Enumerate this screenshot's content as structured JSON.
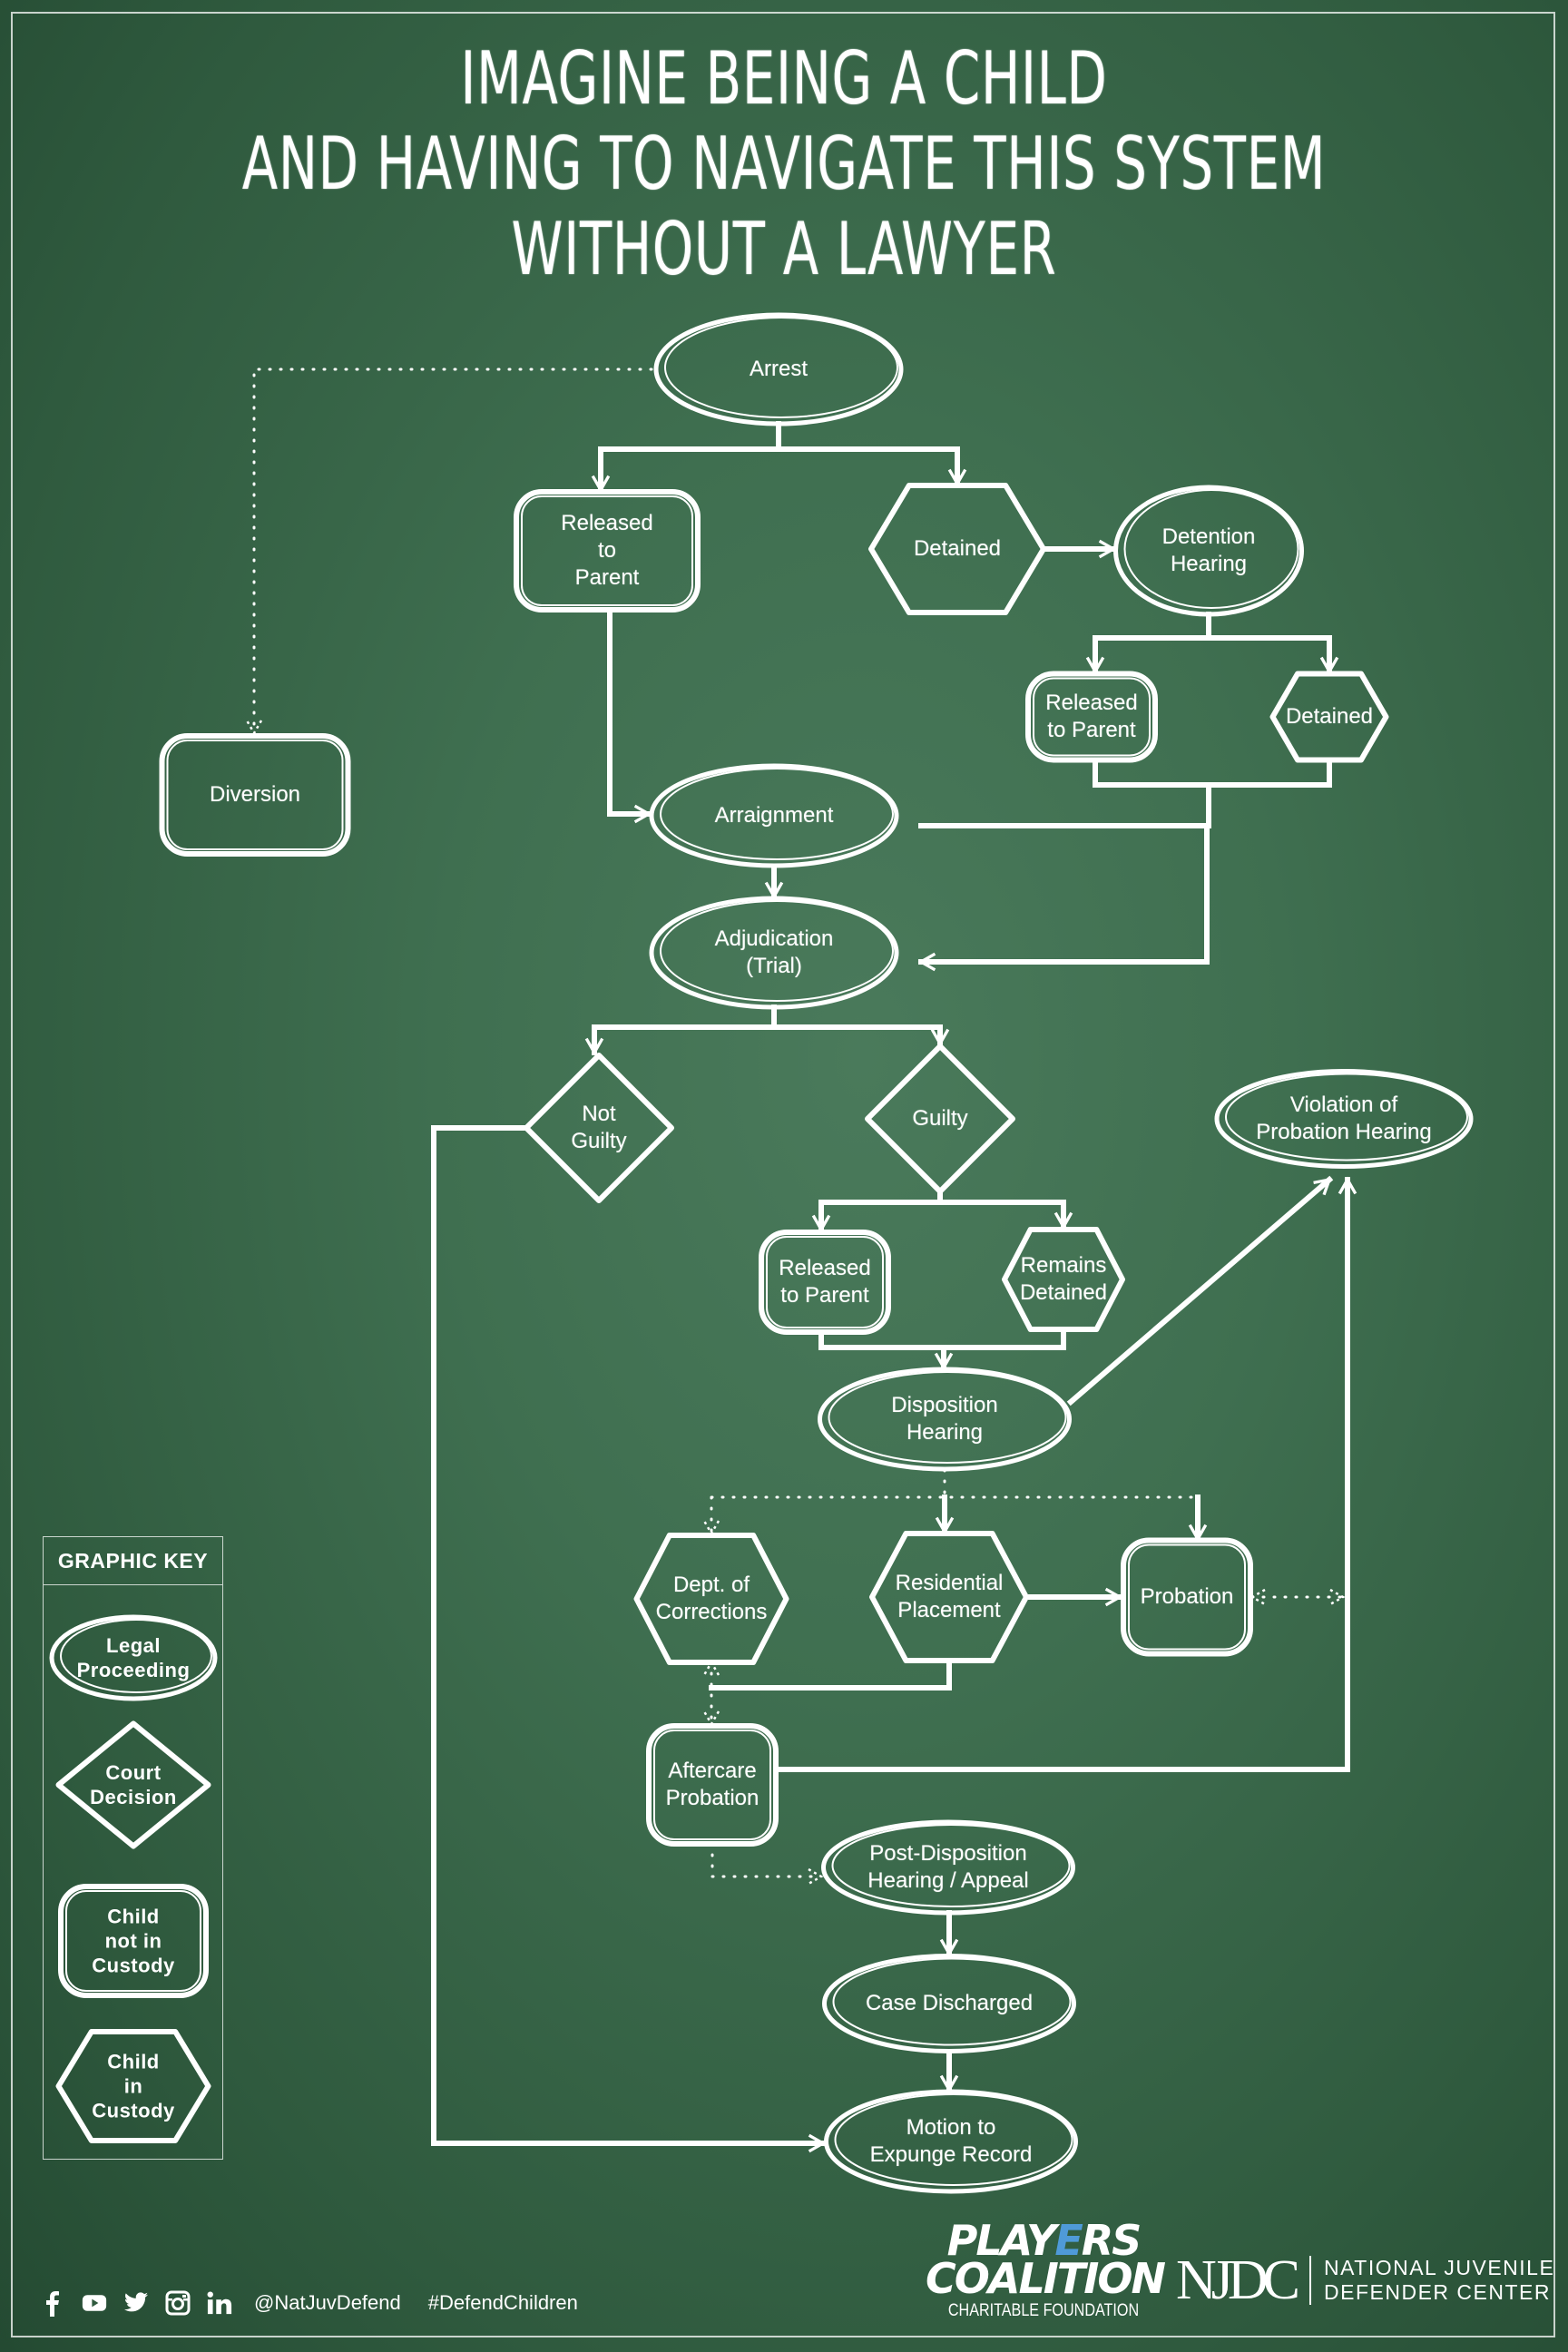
{
  "title": {
    "lines": [
      "IMAGINE BEING A CHILD",
      "AND HAVING TO NAVIGATE THIS SYSTEM",
      "WITHOUT A LAWYER"
    ]
  },
  "colors": {
    "background": "#3f6f50",
    "chalk": "#ffffff",
    "players_blue": "#4f9ad8"
  },
  "nodes": {
    "arrest": {
      "label": "Arrest",
      "shape": "legal-proceeding"
    },
    "released_to_parent_1": {
      "label": "Released\nto\nParent",
      "shape": "child-not-in-custody"
    },
    "detained_1": {
      "label": "Detained",
      "shape": "child-in-custody"
    },
    "detention_hearing": {
      "label": "Detention\nHearing",
      "shape": "legal-proceeding"
    },
    "released_to_parent_2": {
      "label": "Released\nto Parent",
      "shape": "child-not-in-custody"
    },
    "detained_2": {
      "label": "Detained",
      "shape": "child-in-custody"
    },
    "diversion": {
      "label": "Diversion",
      "shape": "child-not-in-custody"
    },
    "arraignment": {
      "label": "Arraignment",
      "shape": "legal-proceeding"
    },
    "adjudication": {
      "label": "Adjudication\n(Trial)",
      "shape": "legal-proceeding"
    },
    "not_guilty": {
      "label": "Not\nGuilty",
      "shape": "court-decision"
    },
    "guilty": {
      "label": "Guilty",
      "shape": "court-decision"
    },
    "violation_hearing": {
      "label": "Violation of\nProbation Hearing",
      "shape": "legal-proceeding"
    },
    "released_to_parent_3": {
      "label": "Released\nto Parent",
      "shape": "child-not-in-custody"
    },
    "remains_detained": {
      "label": "Remains\nDetained",
      "shape": "child-in-custody"
    },
    "disposition_hearing": {
      "label": "Disposition\nHearing",
      "shape": "legal-proceeding"
    },
    "dept_corrections": {
      "label": "Dept. of\nCorrections",
      "shape": "child-in-custody"
    },
    "residential_placement": {
      "label": "Residential\nPlacement",
      "shape": "child-in-custody"
    },
    "probation": {
      "label": "Probation",
      "shape": "child-not-in-custody"
    },
    "aftercare_probation": {
      "label": "Aftercare\nProbation",
      "shape": "child-not-in-custody"
    },
    "post_disposition": {
      "label": "Post-Disposition\nHearing / Appeal",
      "shape": "legal-proceeding"
    },
    "case_discharged": {
      "label": "Case Discharged",
      "shape": "legal-proceeding"
    },
    "motion_expunge": {
      "label": "Motion to\nExpunge Record",
      "shape": "legal-proceeding"
    }
  },
  "edges": [
    {
      "from": "arrest",
      "to": "released_to_parent_1",
      "style": "solid"
    },
    {
      "from": "arrest",
      "to": "detained_1",
      "style": "solid"
    },
    {
      "from": "arrest",
      "to": "diversion",
      "style": "dotted"
    },
    {
      "from": "detained_1",
      "to": "detention_hearing",
      "style": "solid"
    },
    {
      "from": "detention_hearing",
      "to": "released_to_parent_2",
      "style": "solid"
    },
    {
      "from": "detention_hearing",
      "to": "detained_2",
      "style": "solid"
    },
    {
      "from": "released_to_parent_1",
      "to": "arraignment",
      "style": "solid"
    },
    {
      "from": "released_to_parent_2",
      "to": "arraignment",
      "style": "solid"
    },
    {
      "from": "detained_2",
      "to": "adjudication",
      "style": "solid"
    },
    {
      "from": "arraignment",
      "to": "adjudication",
      "style": "solid"
    },
    {
      "from": "adjudication",
      "to": "not_guilty",
      "style": "solid"
    },
    {
      "from": "adjudication",
      "to": "guilty",
      "style": "solid"
    },
    {
      "from": "not_guilty",
      "to": "motion_expunge",
      "style": "solid"
    },
    {
      "from": "guilty",
      "to": "released_to_parent_3",
      "style": "solid"
    },
    {
      "from": "guilty",
      "to": "remains_detained",
      "style": "solid"
    },
    {
      "from": "released_to_parent_3",
      "to": "disposition_hearing",
      "style": "solid"
    },
    {
      "from": "remains_detained",
      "to": "disposition_hearing",
      "style": "solid"
    },
    {
      "from": "disposition_hearing",
      "to": "violation_hearing",
      "style": "dotted"
    },
    {
      "from": "disposition_hearing",
      "to": "dept_corrections",
      "style": "solid"
    },
    {
      "from": "disposition_hearing",
      "to": "residential_placement",
      "style": "solid"
    },
    {
      "from": "disposition_hearing",
      "to": "probation",
      "style": "solid"
    },
    {
      "from": "residential_placement",
      "to": "probation",
      "style": "dotted-bidirectional"
    },
    {
      "from": "probation",
      "to": "violation_hearing",
      "style": "dotted-bidirectional"
    },
    {
      "from": "dept_corrections",
      "to": "aftercare_probation",
      "style": "solid"
    },
    {
      "from": "residential_placement",
      "to": "aftercare_probation",
      "style": "solid"
    },
    {
      "from": "aftercare_probation",
      "to": "violation_hearing",
      "style": "dotted"
    },
    {
      "from": "aftercare_probation",
      "to": "post_disposition",
      "style": "solid"
    },
    {
      "from": "post_disposition",
      "to": "case_discharged",
      "style": "solid"
    },
    {
      "from": "case_discharged",
      "to": "motion_expunge",
      "style": "solid"
    }
  ],
  "graphic_key": {
    "title": "GRAPHIC KEY",
    "items": [
      {
        "label": "Legal\nProceeding",
        "shape": "legal-proceeding"
      },
      {
        "label": "Court\nDecision",
        "shape": "court-decision"
      },
      {
        "label": "Child\nnot in\nCustody",
        "shape": "child-not-in-custody"
      },
      {
        "label": "Child\nin\nCustody",
        "shape": "child-in-custody"
      }
    ]
  },
  "footer": {
    "social_icons": [
      "facebook-icon",
      "youtube-icon",
      "twitter-icon",
      "instagram-icon",
      "linkedin-icon"
    ],
    "handle": "@NatJuvDefend",
    "hashtag": "#DefendChildren",
    "players_coalition": {
      "line1_a": "PLAY",
      "line1_b": "E",
      "line1_c": "RS",
      "line2": "COALITION",
      "sub": "CHARITABLE FOUNDATION"
    },
    "njdc": {
      "mark": "NJDC",
      "line1": "NATIONAL JUVENILE",
      "line2": "DEFENDER CENTER"
    }
  }
}
